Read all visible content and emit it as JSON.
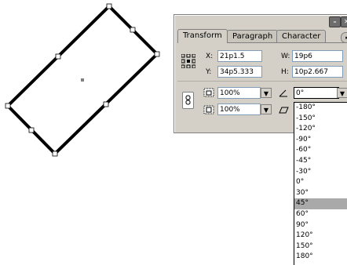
{
  "canvas": {
    "rect_color": "#000000",
    "handle_color": "#ffffff",
    "center_point_color": "#808080"
  },
  "window": {
    "minimize_glyph": "–",
    "close_glyph": "✕"
  },
  "tabs": [
    {
      "label": "Transform",
      "active": true
    },
    {
      "label": "Paragraph",
      "active": false
    },
    {
      "label": "Character",
      "active": false
    }
  ],
  "transform": {
    "x_label": "X:",
    "x_value": "21p1.5",
    "y_label": "Y:",
    "y_value": "34p5.333",
    "w_label": "W:",
    "w_value": "19p6",
    "h_label": "H:",
    "h_value": "10p2.667",
    "scale_x_value": "100%",
    "scale_y_value": "100%",
    "rotation_value": "0°"
  },
  "rotation_options": [
    "-180°",
    "-150°",
    "-120°",
    "-90°",
    "-60°",
    "-45°",
    "-30°",
    "0°",
    "30°",
    "45°",
    "60°",
    "90°",
    "120°",
    "150°",
    "180°"
  ],
  "rotation_highlighted": "45°",
  "icons": {
    "more": "▸",
    "dropdown": "▼"
  }
}
